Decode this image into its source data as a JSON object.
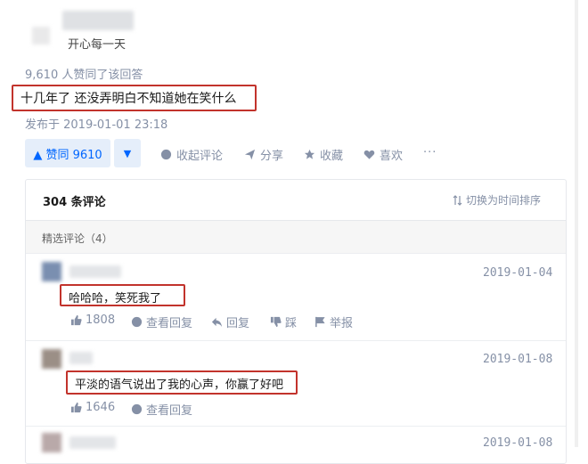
{
  "author": {
    "bio": "开心每一天"
  },
  "answer": {
    "upvote_summary": "9,610 人赞同了该回答",
    "text": "十几年了 还没弄明白不知道她在笑什么",
    "published": "发布于 2019-01-01 23:18"
  },
  "actions": {
    "upvote_label": "▲ 赞同 9610",
    "downvote_icon": "▼",
    "collapse_comments": "收起评论",
    "share": "分享",
    "favorite": "收藏",
    "like": "喜欢",
    "more": "···"
  },
  "comments": {
    "count_label": "304 条评论",
    "sort_toggle": "切换为时间排序",
    "featured_label": "精选评论（4）",
    "items": [
      {
        "date": "2019-01-04",
        "text": "哈哈哈，笑死我了",
        "likes": "1808",
        "view_replies": "查看回复",
        "reply": "回复",
        "dislike": "踩",
        "report": "举报"
      },
      {
        "date": "2019-01-08",
        "text": "平淡的语气说出了我的心声，你赢了好吧",
        "likes": "1646",
        "view_replies": "查看回复"
      },
      {
        "date": "2019-01-08"
      }
    ]
  },
  "colors": {
    "accent": "#0066ff",
    "highlight_box": "#c2332c",
    "muted": "#8590a6"
  }
}
